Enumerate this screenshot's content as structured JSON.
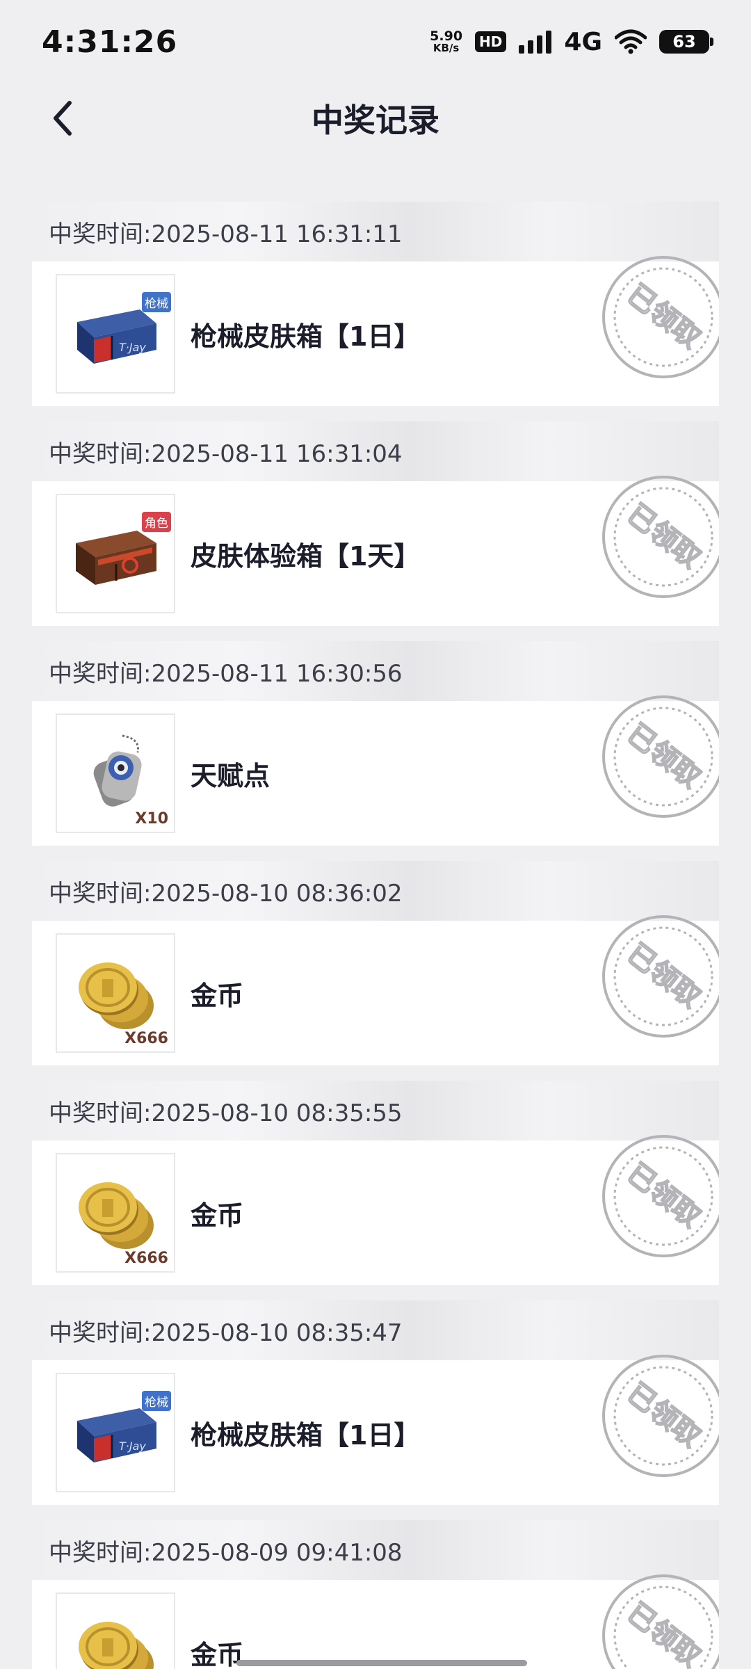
{
  "status_bar": {
    "time": "4:31:26",
    "net_speed_value": "5.90",
    "net_speed_unit": "KB/s",
    "hd": "HD",
    "network": "4G",
    "battery": "63"
  },
  "header": {
    "title": "中奖记录",
    "back_icon": "chevron-left-icon"
  },
  "stamp_text": "已领取",
  "records": [
    {
      "time": "中奖时间:2025-08-11 16:31:11",
      "name": "枪械皮肤箱【1日】",
      "icon": "weapon-skin-crate",
      "tag": "枪械",
      "qty": ""
    },
    {
      "time": "中奖时间:2025-08-11 16:31:04",
      "name": "皮肤体验箱【1天】",
      "icon": "skin-trial-crate",
      "tag": "角色",
      "qty": ""
    },
    {
      "time": "中奖时间:2025-08-11 16:30:56",
      "name": "天赋点",
      "icon": "dog-tag",
      "tag": "",
      "qty": "X10"
    },
    {
      "time": "中奖时间:2025-08-10 08:36:02",
      "name": "金币",
      "icon": "gold-coins",
      "tag": "",
      "qty": "X666"
    },
    {
      "time": "中奖时间:2025-08-10 08:35:55",
      "name": "金币",
      "icon": "gold-coins",
      "tag": "",
      "qty": "X666"
    },
    {
      "time": "中奖时间:2025-08-10 08:35:47",
      "name": "枪械皮肤箱【1日】",
      "icon": "weapon-skin-crate",
      "tag": "枪械",
      "qty": ""
    },
    {
      "time": "中奖时间:2025-08-09 09:41:08",
      "name": "金币",
      "icon": "gold-coins",
      "tag": "",
      "qty": ""
    }
  ],
  "colors": {
    "background": "#efeff2",
    "title": "#1b1d2b",
    "stamp": "#b4b4b8",
    "tag_weapon": "#3f72c8",
    "tag_role": "#d8434b"
  }
}
